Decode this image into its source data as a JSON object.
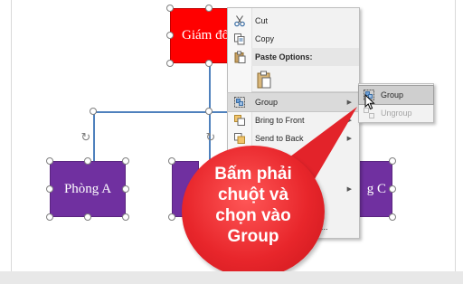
{
  "shapes": {
    "top": "Giám đốc",
    "left": "Phòng A",
    "right": "g C"
  },
  "context_menu": {
    "cut": "Cut",
    "copy": "Copy",
    "paste_options": "Paste Options:",
    "group": "Group",
    "bring_to_front": "Bring to Front",
    "send_to_back": "Send to Back",
    "partial_item": "...ns..."
  },
  "submenu": {
    "group": "Group",
    "ungroup": "Ungroup"
  },
  "callout": {
    "line1": "Bấm phải",
    "line2": "chuột và",
    "line3": "chọn vào",
    "line4": "Group"
  },
  "colors": {
    "top_shape": "#ff0000",
    "department_shape": "#7030a0",
    "connector": "#4f81bd",
    "callout": "#e8262b"
  }
}
